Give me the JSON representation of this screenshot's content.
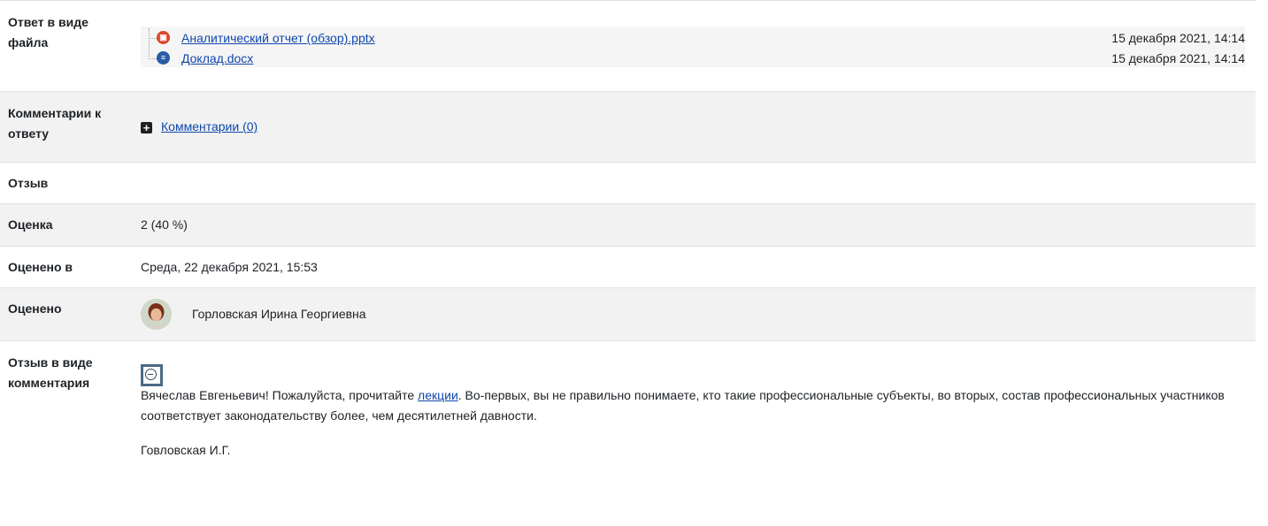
{
  "rows": {
    "file_answer": {
      "label": "Ответ в виде файла",
      "files": [
        {
          "name": "Аналитический отчет (обзор).pptx",
          "date": "15 декабря 2021, 14:14",
          "icon": "pptx-file-icon",
          "color": "#d9472b"
        },
        {
          "name": "Доклад.docx",
          "date": "15 декабря 2021, 14:14",
          "icon": "docx-file-icon",
          "color": "#2b5aa8"
        }
      ]
    },
    "comments": {
      "label": "Комментарии к ответу",
      "link": "Комментарии (0)"
    },
    "feedback": {
      "label": "Отзыв"
    },
    "grade": {
      "label": "Оценка",
      "value": "2 (40 %)"
    },
    "graded_on": {
      "label": "Оценено в",
      "value": "Среда, 22 декабря 2021, 15:53"
    },
    "graded_by": {
      "label": "Оценено",
      "name": "Горловская Ирина Георгиевна"
    },
    "feedback_comment": {
      "label": "Отзыв в виде комментария",
      "text_before": "Вячеслав Евгеньевич! Пожалуйста, прочитайте ",
      "link": "лекции",
      "text_after": ". Во-первых, вы не правильно понимаете, кто такие профессиональные субъекты, во вторых,  состав профессиональных участников соответствует законодательству более, чем десятилетней давности.",
      "signature": "Говловская И.Г."
    }
  },
  "colors": {
    "link": "#0f47ad",
    "shade": "#f2f2f2",
    "border": "#dee2e6"
  }
}
